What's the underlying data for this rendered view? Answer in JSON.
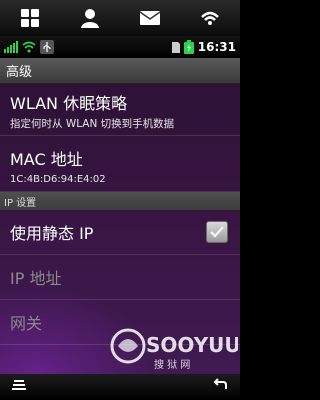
{
  "status": {
    "time": "16:31"
  },
  "screen": {
    "title": "高级"
  },
  "wlan_sleep": {
    "label": "WLAN 休眠策略",
    "summary": "指定何时从 WLAN 切换到手机数据"
  },
  "mac": {
    "label": "MAC 地址",
    "value": "1C:4B:D6:94:E4:02"
  },
  "ip_section": {
    "header": "IP 设置"
  },
  "static_ip": {
    "label": "使用静态 IP",
    "checked": true
  },
  "ip_address": {
    "label": "IP 地址"
  },
  "gateway": {
    "label": "网关"
  },
  "watermark": {
    "text": "SOOYUU",
    "subtext": "搜 狱 网"
  },
  "colors": {
    "panel_bg": "#3a1646",
    "header_bg": "#4a4a4a",
    "accent": "#2bd44a",
    "disabled_text": "#8a8a8a"
  }
}
